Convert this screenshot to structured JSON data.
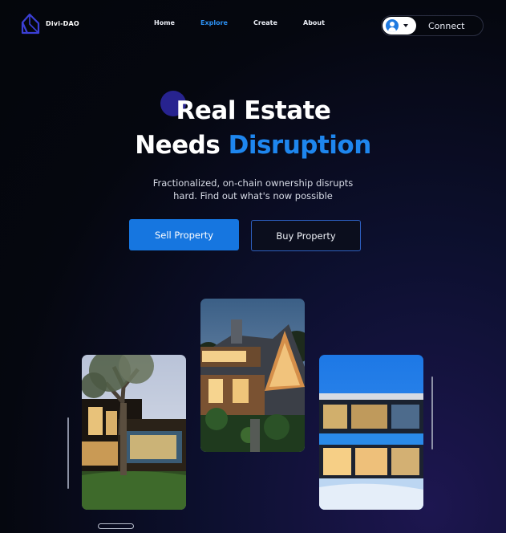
{
  "brand": {
    "name": "Divi-DAO",
    "logo_icon": "house-outline-icon"
  },
  "nav": {
    "items": [
      {
        "label": "Home"
      },
      {
        "label": "Explore",
        "active": true
      },
      {
        "label": "Create"
      },
      {
        "label": "About"
      }
    ]
  },
  "wallet": {
    "connect_label": "Connect",
    "avatar_icon": "user-icon",
    "dropdown_icon": "caret-down-icon"
  },
  "hero": {
    "title_line1": "Real Estate",
    "title_line2_plain": "Needs ",
    "title_line2_accent": "Disruption",
    "subtitle_line1": "Fractionalized, on-chain ownership disrupts",
    "subtitle_line2": "hard. Find out what's now possible",
    "primary_button": "Sell Property",
    "secondary_button": "Buy Property"
  },
  "gallery": {
    "cards": [
      {
        "subject": "modern-house-with-tree"
      },
      {
        "subject": "wooden-house-at-dusk"
      },
      {
        "subject": "glass-house-in-snow"
      }
    ]
  },
  "colors": {
    "accent": "#1e86ee",
    "primary_button": "#1676e0",
    "background": "#05070f"
  }
}
